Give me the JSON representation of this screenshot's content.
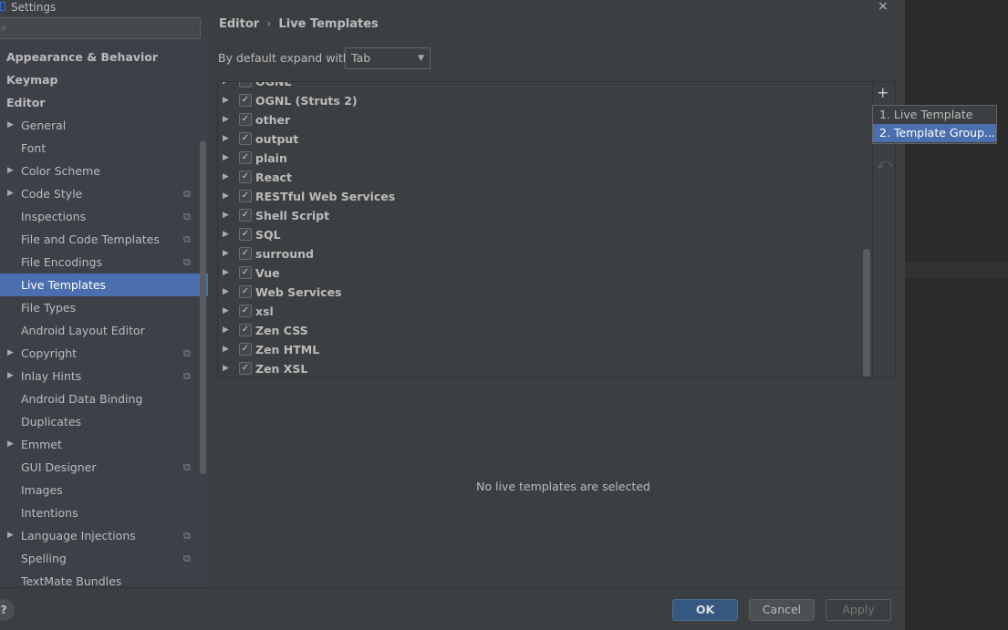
{
  "window": {
    "title": "Settings"
  },
  "sidebar": {
    "search_placeholder": "",
    "items": [
      {
        "label": "Appearance & Behavior",
        "level": 0
      },
      {
        "label": "Keymap",
        "level": 0
      },
      {
        "label": "Editor",
        "level": 0
      },
      {
        "label": "General",
        "level": 1,
        "expandable": true
      },
      {
        "label": "Font",
        "level": 1
      },
      {
        "label": "Color Scheme",
        "level": 1,
        "expandable": true
      },
      {
        "label": "Code Style",
        "level": 1,
        "expandable": true,
        "copy": true
      },
      {
        "label": "Inspections",
        "level": 1,
        "copy": true
      },
      {
        "label": "File and Code Templates",
        "level": 1,
        "copy": true
      },
      {
        "label": "File Encodings",
        "level": 1,
        "copy": true
      },
      {
        "label": "Live Templates",
        "level": 1,
        "selected": true
      },
      {
        "label": "File Types",
        "level": 1
      },
      {
        "label": "Android Layout Editor",
        "level": 1
      },
      {
        "label": "Copyright",
        "level": 1,
        "expandable": true,
        "copy": true
      },
      {
        "label": "Inlay Hints",
        "level": 1,
        "expandable": true,
        "copy": true
      },
      {
        "label": "Android Data Binding",
        "level": 1
      },
      {
        "label": "Duplicates",
        "level": 1
      },
      {
        "label": "Emmet",
        "level": 1,
        "expandable": true
      },
      {
        "label": "GUI Designer",
        "level": 1,
        "copy": true
      },
      {
        "label": "Images",
        "level": 1
      },
      {
        "label": "Intentions",
        "level": 1
      },
      {
        "label": "Language Injections",
        "level": 1,
        "expandable": true,
        "copy": true
      },
      {
        "label": "Spelling",
        "level": 1,
        "copy": true
      },
      {
        "label": "TextMate Bundles",
        "level": 1
      }
    ]
  },
  "breadcrumb": {
    "parent": "Editor",
    "separator": "›",
    "current": "Live Templates"
  },
  "expand": {
    "label": "By default expand with",
    "value": "Tab"
  },
  "groups": [
    "OGNL",
    "OGNL (Struts 2)",
    "other",
    "output",
    "plain",
    "React",
    "RESTful Web Services",
    "Shell Script",
    "SQL",
    "surround",
    "Vue",
    "Web Services",
    "xsl",
    "Zen CSS",
    "Zen HTML",
    "Zen XSL"
  ],
  "toolbar": {
    "add": "+",
    "remove": "−",
    "revert": "⤺"
  },
  "popup": {
    "items": [
      "1. Live Template",
      "2. Template Group..."
    ],
    "selected": 1
  },
  "empty_message": "No live templates are selected",
  "footer": {
    "help": "?",
    "ok": "OK",
    "cancel": "Cancel",
    "apply": "Apply"
  },
  "colors": {
    "accent": "#4b6eaf",
    "ok": "#365880",
    "bg": "#3c3f41"
  }
}
